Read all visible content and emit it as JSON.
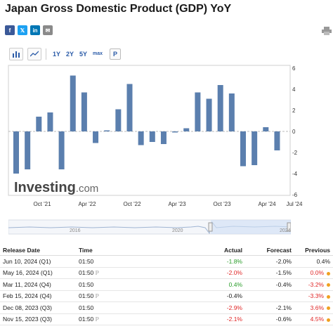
{
  "page": {
    "title": "Japan Gross Domestic Product (GDP) YoY"
  },
  "share": [
    "f",
    "𝕏",
    "in",
    "✉"
  ],
  "toolbar": {
    "ranges": [
      "1Y",
      "2Y",
      "5Y",
      "max"
    ],
    "p_label": "P"
  },
  "watermark": {
    "brand": "Investing",
    "suffix": ".com"
  },
  "chart_data": {
    "type": "bar",
    "values": [
      -4.0,
      -3.6,
      1.4,
      1.8,
      -3.6,
      5.3,
      3.7,
      -1.1,
      0.1,
      2.1,
      4.5,
      -1.3,
      -1.0,
      -1.2,
      -0.1,
      0.3,
      3.7,
      3.1,
      4.4,
      3.6,
      -3.3,
      -3.2,
      0.4,
      -1.8
    ],
    "ylim": [
      -6,
      6
    ],
    "yticks": [
      "6",
      "4",
      "2",
      "0",
      "-2",
      "-4",
      "-6"
    ],
    "xticks": [
      "Oct '21",
      "Apr '22",
      "Oct '22",
      "Apr '23",
      "Oct '23",
      "Apr '24",
      "Jul '24"
    ],
    "grid": false,
    "bar_color": "#5b7fae"
  },
  "navigator": {
    "labels": [
      "2016",
      "2020",
      "2024"
    ]
  },
  "table": {
    "headers": [
      "Release Date",
      "Time",
      "Actual",
      "Forecast",
      "Previous"
    ],
    "rows": [
      {
        "date": "Jun 10, 2024 (Q1)",
        "time": "01:50",
        "p": false,
        "actual": "-1.8%",
        "actual_cls": "pos",
        "forecast": "-2.0%",
        "previous": "0.4%",
        "previous_cls": "neu",
        "dot": false
      },
      {
        "date": "May 16, 2024 (Q1)",
        "time": "01:50",
        "p": true,
        "actual": "-2.0%",
        "actual_cls": "neg",
        "forecast": "-1.5%",
        "previous": "0.0%",
        "previous_cls": "neg",
        "dot": true
      },
      {
        "date": "Mar 11, 2024 (Q4)",
        "time": "01:50",
        "p": false,
        "actual": "0.4%",
        "actual_cls": "pos",
        "forecast": "-0.4%",
        "previous": "-3.2%",
        "previous_cls": "neg",
        "dot": true
      },
      {
        "date": "Feb 15, 2024 (Q4)",
        "time": "01:50",
        "p": true,
        "actual": "-0.4%",
        "actual_cls": "neu",
        "forecast": "",
        "previous": "-3.3%",
        "previous_cls": "neg",
        "dot": true
      },
      {
        "date": "Dec 08, 2023 (Q3)",
        "time": "01:50",
        "p": false,
        "actual": "-2.9%",
        "actual_cls": "neg",
        "forecast": "-2.1%",
        "previous": "3.6%",
        "previous_cls": "neg",
        "dot": true
      },
      {
        "date": "Nov 15, 2023 (Q3)",
        "time": "01:50",
        "p": true,
        "actual": "-2.1%",
        "actual_cls": "neg",
        "forecast": "-0.6%",
        "previous": "4.5%",
        "previous_cls": "neg",
        "dot": true
      }
    ]
  }
}
